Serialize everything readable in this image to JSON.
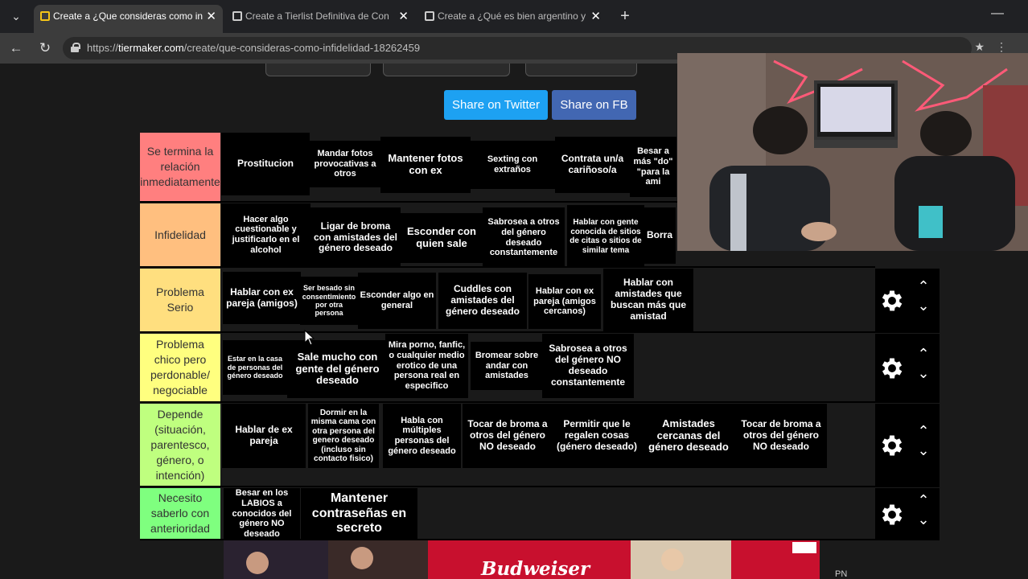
{
  "browser": {
    "tabs": [
      {
        "title": "Create a ¿Que consideras como in",
        "active": true
      },
      {
        "title": "Create a Tierlist Definitiva de Con",
        "active": false
      },
      {
        "title": "Create a ¿Qué es bien argentino y",
        "active": false
      }
    ],
    "url_prefix": "https://",
    "url_domain": "tiermaker.com",
    "url_path": "/create/que-consideras-como-infidelidad-18262459"
  },
  "share": {
    "twitter": "Share on Twitter",
    "facebook": "Share on FB"
  },
  "tiers": [
    {
      "label": "Se termina la relación inmediatamente",
      "color": "#ff7f7f",
      "items": [
        "Prostitucion",
        "Mandar fotos provocativas a otros",
        "Mantener fotos con ex",
        "Sexting con extraños",
        "Contrata un/a cariñoso/a",
        "Besar a más \"do\" \"para la ami"
      ]
    },
    {
      "label": "Infidelidad",
      "color": "#ffbf7f",
      "items": [
        "Hacer algo cuestionable y justificarlo en el alcohol",
        "Ligar de broma con amistades del género deseado",
        "Esconder con quien sale",
        "Sabrosea a otros del género deseado constantemente",
        "Hablar con gente conocida de sitios de citas o sitios de similar tema",
        "Borra"
      ]
    },
    {
      "label": "Problema Serio",
      "color": "#ffdf7f",
      "items": [
        "Hablar con ex pareja (amigos)",
        "Ser besado sin consentimiento por otra persona",
        "Esconder algo en general",
        "Cuddles con amistades del género deseado",
        "Hablar con ex pareja (amigos cercanos)",
        "Hablar con amistades que buscan más que amistad"
      ]
    },
    {
      "label": "Problema chico pero perdonable/ negociable",
      "color": "#ffff7f",
      "items": [
        "Estar en la casa de personas del género deseado",
        "Sale mucho con gente del género deseado",
        "Mira porno, fanfic, o cualquier medio erotico de una persona real en especifico",
        "Bromear sobre andar con amistades",
        "Sabrosea a otros del género NO deseado constantemente"
      ]
    },
    {
      "label": "Depende (situación, parentesco, género, o intención)",
      "color": "#bfff7f",
      "items": [
        "Hablar de ex pareja",
        "Dormir en la misma cama con otra persona del genero deseado (incluso sin contacto fisico)",
        "Habla con múltiples personas del género deseado",
        "Tocar de broma a otros del género NO deseado",
        "Permitir que le regalen cosas (género deseado)",
        "Amistades cercanas del género deseado",
        "Tocar de broma a otros del género NO deseado"
      ]
    },
    {
      "label": "Necesito saberlo con anterioridad",
      "color": "#7fff7f",
      "items": [
        "Besar en los LABIOS a conocidos del género NO deseado",
        "Mantener contraseñas en secreto"
      ]
    }
  ],
  "ad": {
    "brand": "Budweiser",
    "corner": "PN"
  },
  "colors": {
    "twitter": "#1da1f2",
    "facebook": "#4267b2",
    "ad_red": "#c8102e"
  }
}
